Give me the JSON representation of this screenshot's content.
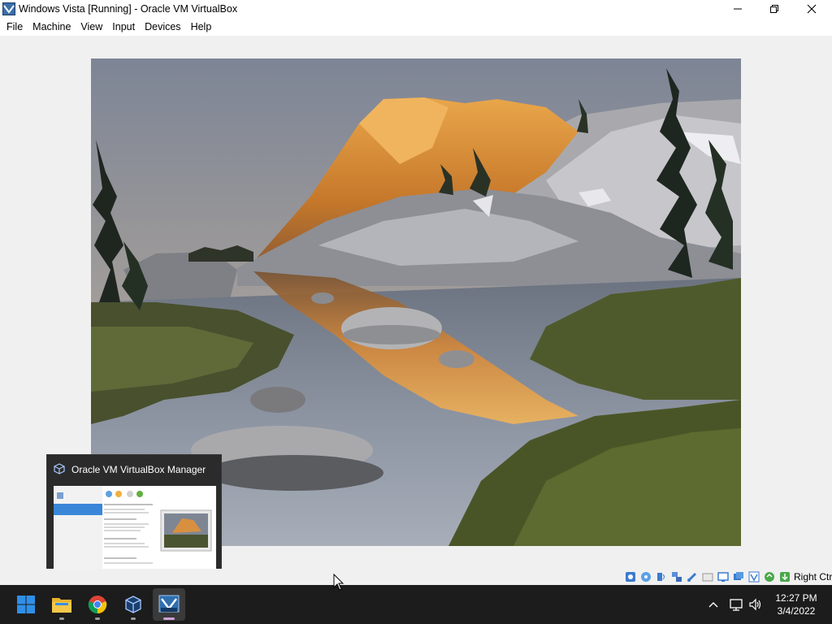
{
  "window": {
    "title": "Windows Vista [Running] - Oracle VM VirtualBox",
    "app_icon": "virtualbox-vm-icon"
  },
  "menu": {
    "items": [
      "File",
      "Machine",
      "View",
      "Input",
      "Devices",
      "Help"
    ]
  },
  "guest": {
    "wallpaper": "mountain-lake-sunset-photo"
  },
  "thumbnail": {
    "title": "Oracle VM VirtualBox Manager",
    "icon": "virtualbox-cube-icon"
  },
  "status_bar": {
    "icons": [
      "hard-disk-icon",
      "optical-drive-icon",
      "audio-icon",
      "network-icon",
      "usb-icon",
      "shared-folder-icon",
      "display-icon",
      "recording-icon",
      "vt-x-icon",
      "mouse-integration-icon",
      "keyboard-capture-icon"
    ],
    "host_key": "Right Ctrl"
  },
  "taskbar": {
    "apps": [
      "windows-start-icon",
      "file-explorer-icon",
      "chrome-icon",
      "virtualbox-manager-icon",
      "windows-vista-vm-icon"
    ],
    "time": "12:27 PM",
    "date": "3/4/2022"
  },
  "colors": {
    "taskbar_bg": "#1c1c1c",
    "start_blue": "#2f8fe8",
    "active_indicator": "#d0a0d8"
  }
}
